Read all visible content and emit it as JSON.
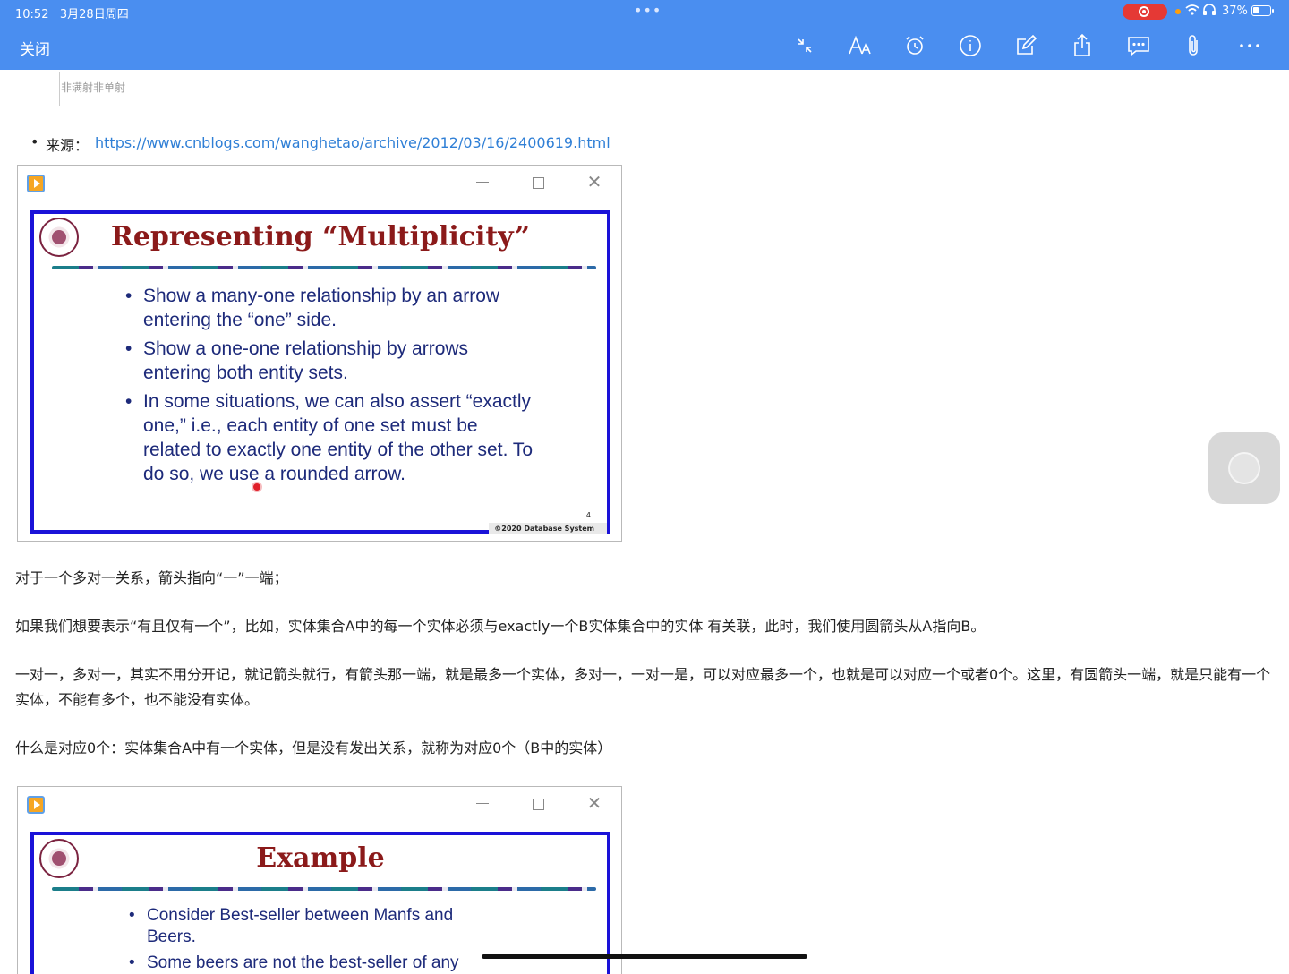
{
  "status_bar": {
    "time": "10:52",
    "date": "3月28日周四",
    "battery": "37%",
    "battery_level": 0.37,
    "accent": "#4a8ef0",
    "record_color": "#e53935"
  },
  "toolbar": {
    "close_label": "关闭",
    "icons": [
      "collapse-icon",
      "text-size-icon",
      "alarm-icon",
      "info-icon",
      "edit-icon",
      "share-icon",
      "comment-icon",
      "attachment-icon",
      "more-icon"
    ]
  },
  "content": {
    "crop_caption": "非满射非单射",
    "source_label": "来源：",
    "source_url": "https://www.cnblogs.com/wanghetao/archive/2012/03/16/2400619.html",
    "slide1": {
      "title": "Representing “Multiplicity”",
      "bullets": [
        "Show a many-one relationship by an arrow entering the “one” side.",
        "Show a one-one relationship by arrows entering both entity sets.",
        "In some situations, we can also assert “exactly one,” i.e., each entity of one set must be related to exactly one entity of the other set.  To do so, we use a rounded arrow."
      ],
      "page_number": "4",
      "footer": "©2020 Database System"
    },
    "para1": "对于一个多对一关系，箭头指向“一”一端；",
    "para2": "如果我们想要表示“有且仅有一个”，比如，实体集合A中的每一个实体必须与exactly一个B实体集合中的实体 有关联，此时，我们使用圆箭头从A指向B。",
    "para3": "一对一，多对一，其实不用分开记，就记箭头就行，有箭头那一端，就是最多一个实体，多对一，一对一是，可以对应最多一个，也就是可以对应一个或者0个。这里，有圆箭头一端，就是只能有一个实体，不能有多个，也不能没有实体。",
    "para4": "什么是对应0个：实体集合A中有一个实体，但是没有发出关系，就称为对应0个（B中的实体）",
    "slide2": {
      "title": "Example",
      "bullets": [
        "Consider Best-seller between Manfs and Beers.",
        "Some beers are not the best-seller of any"
      ]
    }
  }
}
